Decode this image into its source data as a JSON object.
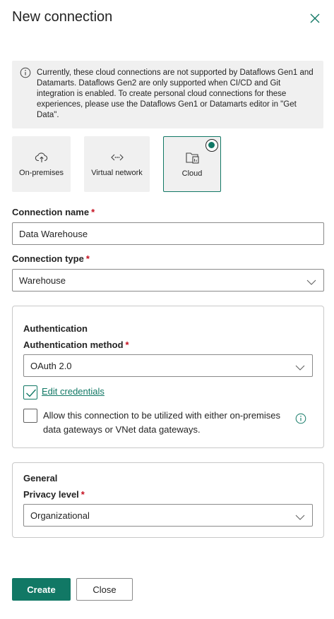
{
  "dialog": {
    "title": "New connection"
  },
  "info": {
    "message": "Currently, these cloud connections are not supported by Dataflows Gen1 and Datamarts. Dataflows Gen2 are only supported when CI/CD and Git integration is enabled. To create personal cloud connections for these experiences, please use the Dataflows Gen1 or Datamarts editor in \"Get Data\"."
  },
  "connection_types": [
    {
      "label": "On-premises",
      "icon": "cloud-upload-icon",
      "selected": false
    },
    {
      "label": "Virtual network",
      "icon": "virtual-network-icon",
      "selected": false
    },
    {
      "label": "Cloud",
      "icon": "cloud-files-icon",
      "selected": true
    }
  ],
  "fields": {
    "connection_name": {
      "label": "Connection name",
      "required_mark": "*",
      "value": "Data Warehouse"
    },
    "connection_type": {
      "label": "Connection type",
      "required_mark": "*",
      "value": "Warehouse"
    }
  },
  "authentication": {
    "heading": "Authentication",
    "method_label": "Authentication method",
    "required_mark": "*",
    "method_value": "OAuth 2.0",
    "edit_credentials": {
      "label": "Edit credentials",
      "checked": true
    },
    "allow_gateways": {
      "label": "Allow this connection to be utilized with either on-premises data gateways or VNet data gateways.",
      "checked": false
    }
  },
  "general": {
    "heading": "General",
    "privacy_label": "Privacy level",
    "required_mark": "*",
    "privacy_value": "Organizational"
  },
  "buttons": {
    "create": "Create",
    "close": "Close"
  },
  "colors": {
    "accent": "#117865",
    "required": "#c50f1f",
    "info_background": "#f0f0f0"
  }
}
